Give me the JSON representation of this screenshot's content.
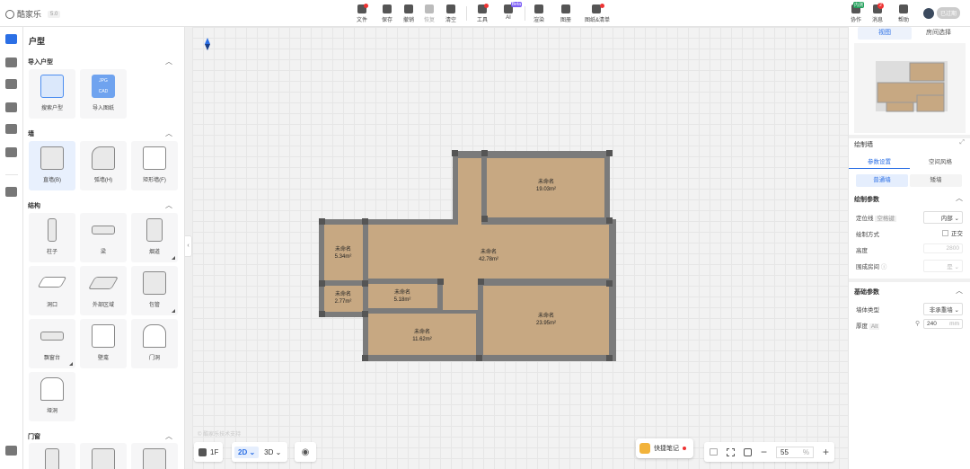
{
  "app": {
    "name": "酷家乐",
    "version": "5.0"
  },
  "toolbar": {
    "items": [
      {
        "label": "文件",
        "name": "file"
      },
      {
        "label": "保存",
        "name": "save"
      },
      {
        "label": "撤销",
        "name": "undo"
      },
      {
        "label": "恢复",
        "name": "redo"
      },
      {
        "label": "清空",
        "name": "clear"
      },
      {
        "label": "工具",
        "name": "tools"
      },
      {
        "label": "AI",
        "name": "ai",
        "badge": "Beta"
      },
      {
        "label": "渲染",
        "name": "render"
      },
      {
        "label": "图册",
        "name": "album"
      },
      {
        "label": "图纸&清单",
        "name": "drawings"
      }
    ],
    "right": [
      {
        "label": "协作",
        "name": "collab",
        "badge": "内测"
      },
      {
        "label": "消息",
        "name": "messages",
        "badge": "2"
      },
      {
        "label": "帮助",
        "name": "help"
      }
    ],
    "account_status": "已过期"
  },
  "catalog": {
    "title": "户型",
    "sections": [
      {
        "title": "导入户型",
        "items": [
          "搜索户型",
          "导入图纸"
        ]
      },
      {
        "title": "墙",
        "items": [
          "直墙(B)",
          "弧墙(H)",
          "矩形墙(F)"
        ]
      },
      {
        "title": "结构",
        "items": [
          "柱子",
          "梁",
          "烟道",
          "洞口",
          "外部区域",
          "包管",
          "飘窗台",
          "壁龛",
          "门洞",
          "垭洞"
        ]
      },
      {
        "title": "门窗",
        "items": []
      }
    ],
    "import_badge_1": "JPG",
    "import_badge_2": "CAD"
  },
  "rooms": [
    {
      "name": "未命名",
      "area": "19.03m²"
    },
    {
      "name": "未命名",
      "area": "5.34m²"
    },
    {
      "name": "未命名",
      "area": "42.78m²"
    },
    {
      "name": "未命名",
      "area": "2.77m²"
    },
    {
      "name": "未命名",
      "area": "5.18m²"
    },
    {
      "name": "未命名",
      "area": "11.62m²"
    },
    {
      "name": "未命名",
      "area": "23.95m²"
    }
  ],
  "canvas": {
    "watermark": "© 酷家乐技术支持",
    "floor_label": "1F",
    "view_2d": "2D",
    "view_3d": "3D",
    "notes_label": "快捷笔记",
    "zoom_value": "55",
    "zoom_unit": "%"
  },
  "right_panel": {
    "tabs": [
      "视图",
      "房间选择"
    ],
    "section_title": "绘制墙",
    "sub_tabs": [
      "参数设置",
      "空间风格"
    ],
    "wall_types": [
      "普通墙",
      "矮墙"
    ],
    "draw_params_title": "绘制参数",
    "positioning_label": "定位线",
    "positioning_hint": "空格键",
    "positioning_value": "内部",
    "draw_mode_label": "绘制方式",
    "draw_mode_value": "正交",
    "height_label": "高度",
    "height_value": "2800",
    "room_enclose_label": "围成房间",
    "room_enclose_value": "是",
    "base_params_title": "基础参数",
    "wall_material_label": "墙体类型",
    "wall_material_value": "非承重墙",
    "thickness_label": "厚度",
    "thickness_hint": "Alt",
    "thickness_value": "240",
    "thickness_unit": "mm"
  },
  "colors": {
    "accent": "#2b6fe5",
    "floor": "#c7a882",
    "wall": "#7b7b7b",
    "alert": "#e33333"
  }
}
